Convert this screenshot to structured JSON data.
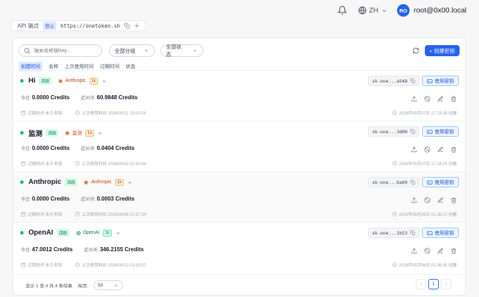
{
  "header": {
    "language": "ZH",
    "avatar_initials": "RO",
    "username": "root@0x00.local"
  },
  "endpoint": {
    "label": "API 端点",
    "badge": "默认",
    "url": "https://onetoken.sh"
  },
  "toolbar": {
    "search_placeholder": "搜索名称或Key...",
    "group_filter": "全部分组",
    "status_filter": "全部状态",
    "create_label": "+ 创建密钥"
  },
  "sort": [
    "创建时间",
    "名称",
    "上次使用时间",
    "过期时间",
    "状态"
  ],
  "keys": [
    {
      "name": "Hi",
      "status": "活跃",
      "provider": "Anthropic",
      "provider_type": "anthropic",
      "multiplier": "1x",
      "key_masked": "sk-one...a548",
      "use_label": "使用密钥",
      "today_label": "今日",
      "today": "0.0000 Credits",
      "month_label": "近30天",
      "month": "60.9848 Credits",
      "expiry": "过期时间 永久有效",
      "last_used": "上次使用时间 2026/05/11 23:03:24",
      "created": "2026年05月07日 17:23:28 创建"
    },
    {
      "name": "监测",
      "status": "活跃",
      "provider": "监测",
      "provider_type": "anthropic",
      "multiplier": "1x",
      "key_masked": "sk-one...3d00",
      "use_label": "使用密钥",
      "today_label": "今日",
      "today": "0.0000 Credits",
      "month_label": "近30天",
      "month": "0.0404 Credits",
      "expiry": "过期时间 永久有效",
      "last_used": "上次使用时间 2026/05/12 02:52:04",
      "created": "2026年05月07日 17:18:03 创建"
    },
    {
      "name": "Anthropic",
      "status": "活跃",
      "provider": "Anthropic",
      "provider_type": "anthropic",
      "multiplier": "1x",
      "key_masked": "sk-one...6a09",
      "use_label": "使用密钥",
      "today_label": "今日",
      "today": "0.0000 Credits",
      "month_label": "近30天",
      "month": "0.0003 Credits",
      "expiry": "过期时间 永久有效",
      "last_used": "上次使用时间 2026/05/06 01:57:24",
      "created": "2026年05月06日 01:36:17 创建"
    },
    {
      "name": "OpenAI",
      "status": "活跃",
      "provider": "OpenAI",
      "provider_type": "openai",
      "multiplier": "1x",
      "key_masked": "sk-one...1b53",
      "use_label": "使用密钥",
      "today_label": "今日",
      "today": "47.0012 Credits",
      "month_label": "近30天",
      "month": "346.2155 Credits",
      "expiry": "过期时间 永久有效",
      "last_used": "上次使用时间 2026/05/13 13:30:57",
      "created": "2026年05月06日 01:36:05 创建"
    }
  ],
  "footer": {
    "summary": "显示 1 至 4 共 4 条结果",
    "per_page_label": "每页:",
    "per_page": "50",
    "current_page": "1"
  },
  "colors": {
    "accent": "#2563eb",
    "active_green": "#10b981",
    "anthropic_orange": "#c2410c"
  }
}
